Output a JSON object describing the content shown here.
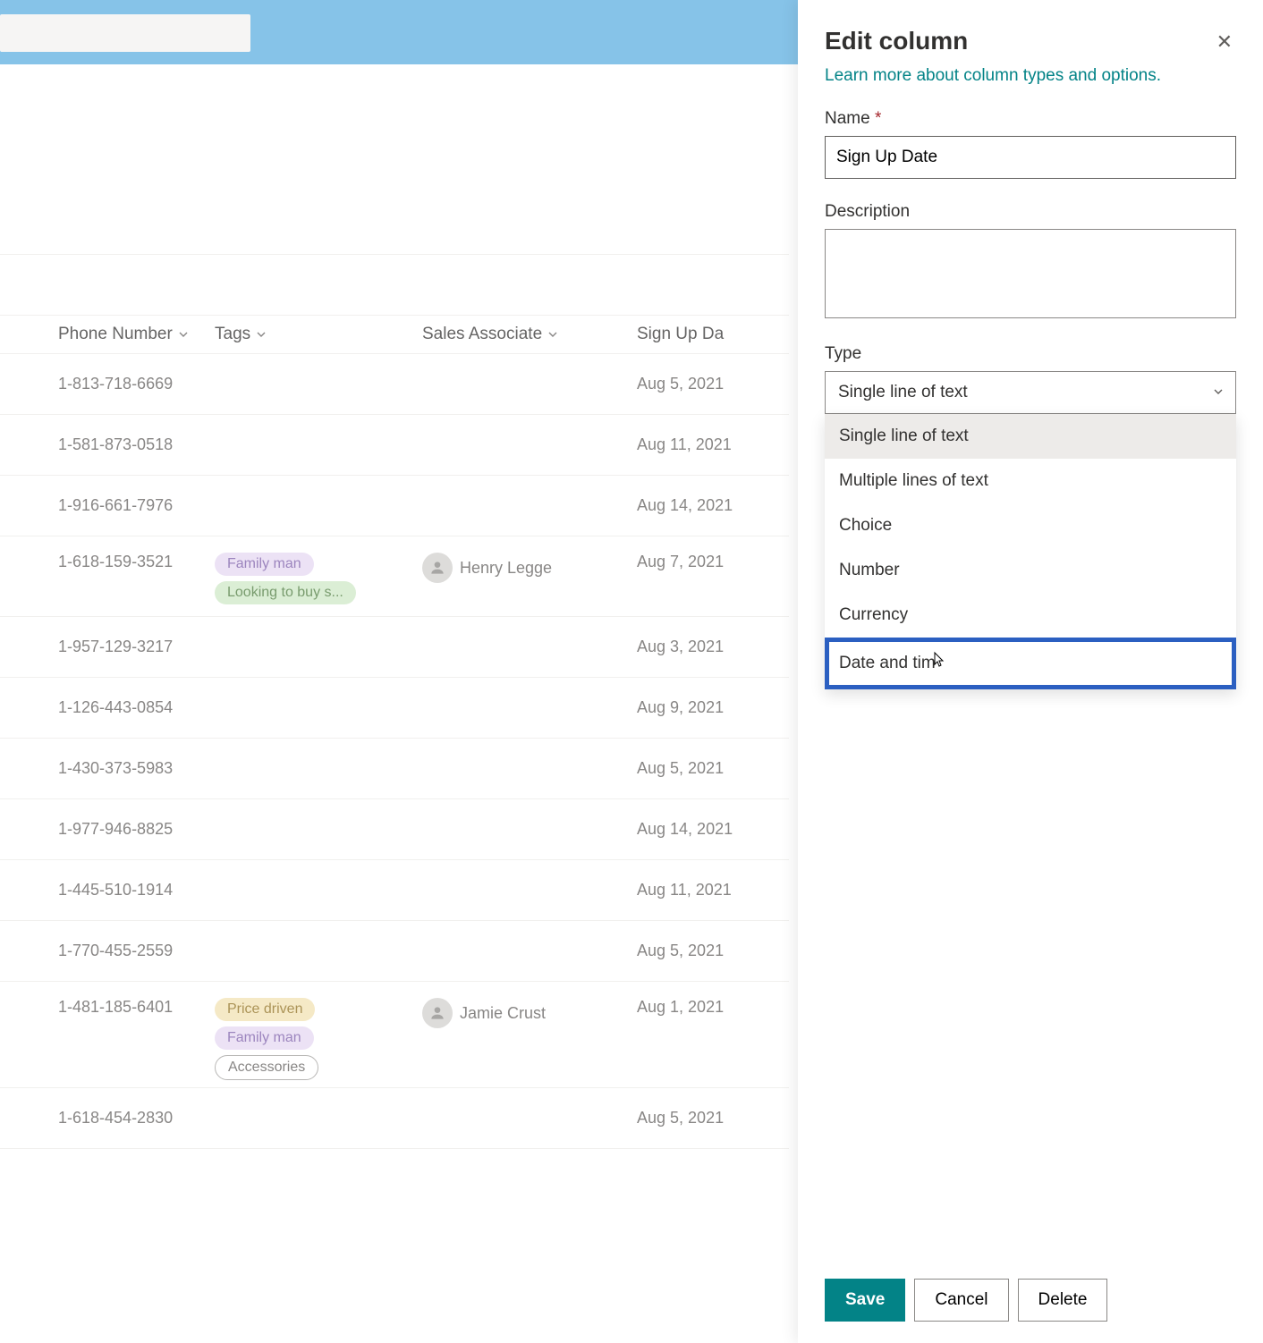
{
  "panel": {
    "title": "Edit column",
    "learn_more": "Learn more about column types and options.",
    "name_label": "Name",
    "name_value": "Sign Up Date",
    "description_label": "Description",
    "description_value": "",
    "type_label": "Type",
    "type_selected": "Single line of text",
    "type_options": [
      "Single line of text",
      "Multiple lines of text",
      "Choice",
      "Number",
      "Currency",
      "Date and time"
    ],
    "type_hover_display": "Date and tim",
    "save_label": "Save",
    "cancel_label": "Cancel",
    "delete_label": "Delete"
  },
  "table": {
    "headers": {
      "phone": "Phone Number",
      "tags": "Tags",
      "sales": "Sales Associate",
      "signup": "Sign Up Da"
    },
    "rows": [
      {
        "phone": "1-813-718-6669",
        "tags": [],
        "sales": "",
        "signup": "Aug 5, 2021"
      },
      {
        "phone": "1-581-873-0518",
        "tags": [],
        "sales": "",
        "signup": "Aug 11, 2021"
      },
      {
        "phone": "1-916-661-7976",
        "tags": [],
        "sales": "",
        "signup": "Aug 14, 2021"
      },
      {
        "phone": "1-618-159-3521",
        "tags": [
          {
            "text": "Family man",
            "c": "purple"
          },
          {
            "text": "Looking to buy s...",
            "c": "green"
          }
        ],
        "sales": "Henry Legge",
        "signup": "Aug 7, 2021"
      },
      {
        "phone": "1-957-129-3217",
        "tags": [],
        "sales": "",
        "signup": "Aug 3, 2021"
      },
      {
        "phone": "1-126-443-0854",
        "tags": [],
        "sales": "",
        "signup": "Aug 9, 2021"
      },
      {
        "phone": "1-430-373-5983",
        "tags": [],
        "sales": "",
        "signup": "Aug 5, 2021"
      },
      {
        "phone": "1-977-946-8825",
        "tags": [],
        "sales": "",
        "signup": "Aug 14, 2021"
      },
      {
        "phone": "1-445-510-1914",
        "tags": [],
        "sales": "",
        "signup": "Aug 11, 2021"
      },
      {
        "phone": "1-770-455-2559",
        "tags": [],
        "sales": "",
        "signup": "Aug 5, 2021"
      },
      {
        "phone": "1-481-185-6401",
        "tags": [
          {
            "text": "Price driven",
            "c": "orange"
          },
          {
            "text": "Family man",
            "c": "purple"
          },
          {
            "text": "Accessories",
            "c": "outline"
          }
        ],
        "sales": "Jamie Crust",
        "signup": "Aug 1, 2021"
      },
      {
        "phone": "1-618-454-2830",
        "tags": [],
        "sales": "",
        "signup": "Aug 5, 2021"
      }
    ]
  }
}
